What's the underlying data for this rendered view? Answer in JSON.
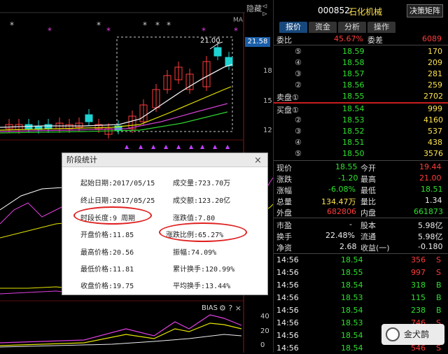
{
  "header": {
    "hide_label": "隐藏",
    "scroll": "⊲ ⊳",
    "ma_label": "MA"
  },
  "chart": {
    "current_price_tag": "21.58",
    "peak_label": "21.00",
    "y_labels": {
      "p18": "18",
      "p15": "15",
      "p12": "12"
    },
    "bias": {
      "label": "BIAS",
      "icons": "⚙ ? ×",
      "y40": "40",
      "y20": "20",
      "y0": "0"
    }
  },
  "right": {
    "code": "000852",
    "name": "石化机械",
    "decision_button": "决策矩阵",
    "tabs": [
      "报价",
      "资金",
      "分析",
      "操作"
    ],
    "weibi": {
      "label": "委比",
      "pct": "45.67%",
      "diff_label": "委差",
      "diff": "6089"
    },
    "sell": [
      {
        "lvl": "⑤",
        "price": "18.59",
        "vol": "170"
      },
      {
        "lvl": "④",
        "price": "18.58",
        "vol": "209"
      },
      {
        "lvl": "③",
        "price": "18.57",
        "vol": "281"
      },
      {
        "lvl": "②",
        "price": "18.56",
        "vol": "259"
      },
      {
        "lvl": "卖盘①",
        "price": "18.55",
        "vol": "2702"
      }
    ],
    "buy": [
      {
        "lvl": "买盘①",
        "price": "18.54",
        "vol": "999"
      },
      {
        "lvl": "②",
        "price": "18.53",
        "vol": "4160"
      },
      {
        "lvl": "③",
        "price": "18.52",
        "vol": "537"
      },
      {
        "lvl": "④",
        "price": "18.51",
        "vol": "438"
      },
      {
        "lvl": "⑤",
        "price": "18.50",
        "vol": "3576"
      }
    ],
    "quote": {
      "xianjia_l": "现价",
      "xianjia": "18.55",
      "jinkai_l": "今开",
      "jinkai": "19.44",
      "zhangdie_l": "涨跌",
      "zhangdie": "-1.20",
      "zuigao_l": "最高",
      "zuigao": "21.00",
      "zhangfu_l": "涨幅",
      "zhangfu": "-6.08%",
      "zuidi_l": "最低",
      "zuidi": "18.51",
      "zongliang_l": "总量",
      "zongliang": "134.47万",
      "liangbi_l": "量比",
      "liangbi": "1.34",
      "waipan_l": "外盘",
      "waipan": "682806",
      "neipan_l": "内盘",
      "neipan": "661873",
      "shiying_l": "市盈",
      "shiying": "-",
      "guben_l": "股本",
      "guben": "5.98亿",
      "huanshou_l": "换手",
      "huanshou": "22.48%",
      "liutong_l": "流通",
      "liutong": "5.98亿",
      "jingzi_l": "净资",
      "jingzi": "2.68",
      "shouyi_l": "收益(一)",
      "shouyi": "-0.180"
    },
    "ticks": [
      {
        "time": "14:56",
        "price": "18.54",
        "vol": "356",
        "dir": "S"
      },
      {
        "time": "14:56",
        "price": "18.55",
        "vol": "997",
        "dir": "S"
      },
      {
        "time": "14:56",
        "price": "18.54",
        "vol": "318",
        "dir": "B"
      },
      {
        "time": "14:56",
        "price": "18.53",
        "vol": "115",
        "dir": "B"
      },
      {
        "time": "14:56",
        "price": "18.54",
        "vol": "238",
        "dir": "B"
      },
      {
        "time": "14:56",
        "price": "18.53",
        "vol": "746",
        "dir": "S"
      },
      {
        "time": "14:56",
        "price": "18.54",
        "vol": "",
        "dir": ""
      },
      {
        "time": "14:56",
        "price": "18.54",
        "vol": "546",
        "dir": "S"
      }
    ]
  },
  "popup": {
    "title": "阶段统计",
    "close": "×",
    "start_date": "起始日期:2017/05/15",
    "end_date": "终止日期:2017/05/25",
    "period_len": "时段长度:9 周期",
    "open_price": "开盘价格:11.85",
    "high_price": "最高价格:20.56",
    "low_price": "最低价格:11.81",
    "close_price": "收盘价格:19.75",
    "volume": "成交量:723.70万",
    "amount": "成交额:123.20亿",
    "change_val": "涨跌值:7.80",
    "change_pct": "涨跌比例:65.27%",
    "amplitude": "振幅:74.09%",
    "cum_turnover": "累计换手:120.99%",
    "avg_turnover": "平均换手:13.44%"
  },
  "watermark": "金犬鹊",
  "colors": {
    "up": "#ff3b3b",
    "down": "#2ee22e",
    "accent": "#17487c"
  }
}
